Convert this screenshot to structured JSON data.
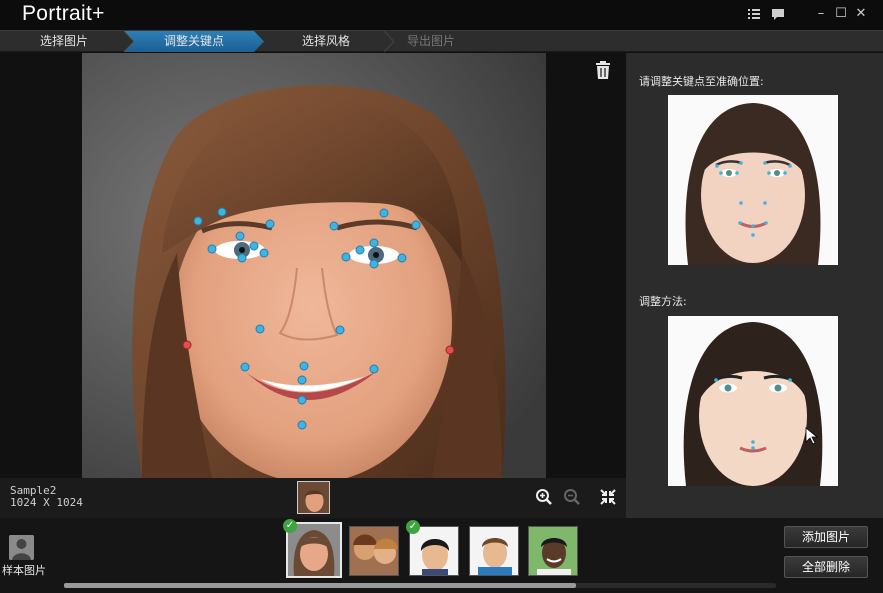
{
  "app": {
    "title": "Portrait+"
  },
  "window_controls": {
    "list_icon": "list-icon",
    "chat_icon": "chat-icon",
    "minimize": "–",
    "maximize": "☐",
    "close": "✕"
  },
  "steps": [
    {
      "label": "选择图片",
      "state": "done"
    },
    {
      "label": "调整关键点",
      "state": "active"
    },
    {
      "label": "选择风格",
      "state": "pending"
    },
    {
      "label": "导出图片",
      "state": "disabled"
    }
  ],
  "image_info": {
    "name": "Sample2",
    "size": "1024 X 1024"
  },
  "right_panel": {
    "instruction": "请调整关键点至准确位置:",
    "method_label": "调整方法:"
  },
  "sample_library": {
    "label": "样本图片"
  },
  "thumbnails": [
    {
      "checked": true,
      "selected": true
    },
    {
      "checked": false,
      "selected": false
    },
    {
      "checked": true,
      "selected": false
    },
    {
      "checked": false,
      "selected": false
    },
    {
      "checked": false,
      "selected": false
    }
  ],
  "buttons": {
    "add_image": "添加图片",
    "delete_all": "全部删除"
  },
  "colors": {
    "accent": "#2d7fb8",
    "keypoint": "#3fb4e0",
    "keypoint_edge": "#e05050",
    "check": "#3fa33f"
  }
}
